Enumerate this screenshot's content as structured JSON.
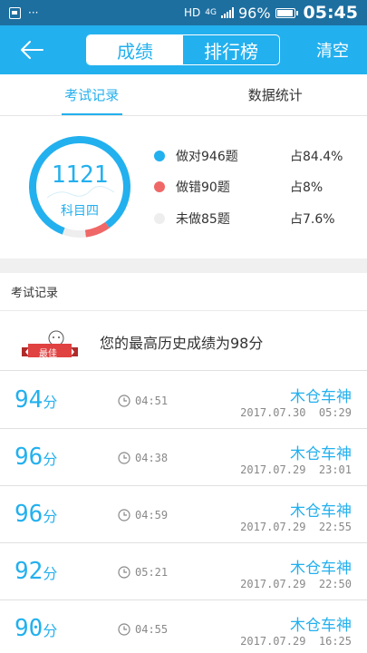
{
  "status_bar": {
    "hd_label": "HD",
    "network_label": "4G",
    "battery_pct": "96%",
    "battery_level": 0.96,
    "time": "05:45"
  },
  "header": {
    "segments": [
      {
        "label": "成绩",
        "active": true
      },
      {
        "label": "排行榜",
        "active": false
      }
    ],
    "clear_label": "清空"
  },
  "tabs": [
    {
      "label": "考试记录",
      "active": true
    },
    {
      "label": "数据统计",
      "active": false
    }
  ],
  "summary": {
    "total": "1121",
    "subject": "科目四",
    "colors": {
      "correct": "#23b0ee",
      "wrong": "#f06767",
      "undone": "#eeeeee"
    },
    "stats": [
      {
        "label": "做对946题",
        "pct": "占84.4%",
        "value": 84.4,
        "key": "correct"
      },
      {
        "label": "做错90题",
        "pct": "占8%",
        "value": 8,
        "key": "wrong"
      },
      {
        "label": "未做85题",
        "pct": "占7.6%",
        "value": 7.6,
        "key": "undone"
      }
    ]
  },
  "records_section": {
    "title": "考试记录",
    "best_badge": "最佳",
    "best_text": "您的最高历史成绩为98分"
  },
  "records": [
    {
      "score": "94",
      "unit": "分",
      "duration": "04:51",
      "title": "木仓车神",
      "date": "2017.07.30  05:29"
    },
    {
      "score": "96",
      "unit": "分",
      "duration": "04:38",
      "title": "木仓车神",
      "date": "2017.07.29  23:01"
    },
    {
      "score": "96",
      "unit": "分",
      "duration": "04:59",
      "title": "木仓车神",
      "date": "2017.07.29  22:55"
    },
    {
      "score": "92",
      "unit": "分",
      "duration": "05:21",
      "title": "木仓车神",
      "date": "2017.07.29  22:50"
    },
    {
      "score": "90",
      "unit": "分",
      "duration": "04:55",
      "title": "木仓车神",
      "date": "2017.07.29  16:25"
    }
  ]
}
